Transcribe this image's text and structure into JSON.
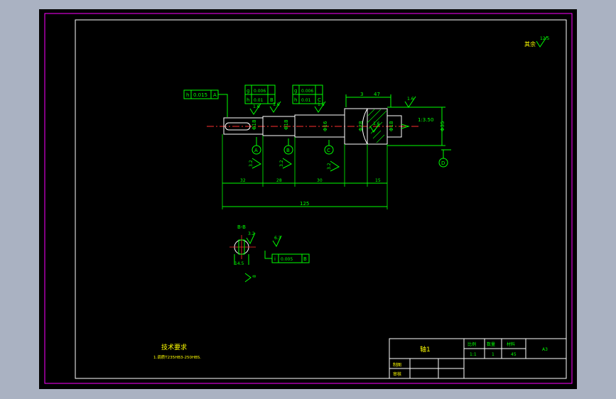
{
  "roughness": {
    "default_symbol": "其余",
    "default_value": "12.5"
  },
  "shaft": {
    "tolerance_frame_left": {
      "symbol": "h",
      "value": "0.015",
      "datum": "A"
    },
    "tolerance_frame_mid": {
      "rows": [
        [
          "g",
          "0.006",
          ""
        ],
        [
          "h",
          "0.01",
          "B"
        ]
      ]
    },
    "tolerance_frame_right": {
      "rows": [
        [
          "g",
          "0.006",
          ""
        ],
        [
          "h",
          "0.01",
          "C"
        ]
      ]
    },
    "roughness_marks": [
      "1.6",
      "1.6",
      "1.6",
      "1.6",
      "1.6"
    ],
    "diameters": [
      "Φ18",
      "Φ18",
      "Φ16",
      "Φ28",
      "Φ18",
      "Φ35"
    ],
    "taper": "1:3.50",
    "dims_top": [
      "3",
      "47"
    ],
    "datums": [
      "A",
      "B",
      "C",
      "D"
    ],
    "roughness_vertical": [
      "3.2",
      "3.2",
      "3.2"
    ],
    "segment_dims": [
      "32",
      "28",
      "30",
      "15"
    ],
    "total_length": "125"
  },
  "section": {
    "label": "B-B",
    "roughness": [
      "3.2",
      "6.3"
    ],
    "tolerance": {
      "symbol": "i",
      "value": "0.005",
      "datum": "B"
    },
    "dims": [
      "14.5",
      "8"
    ]
  },
  "tech_requirements": {
    "title": "技术要求",
    "line1": "1.调质T235HB3-250HBS."
  },
  "title_block": {
    "part_name": "轴1",
    "scale_label": "比例",
    "qty_label": "数量",
    "material_label": "材料",
    "scale": "1:1",
    "qty": "1",
    "material": "45",
    "sheet": "A3",
    "drawn_label": "制图",
    "checked_label": "审核"
  }
}
